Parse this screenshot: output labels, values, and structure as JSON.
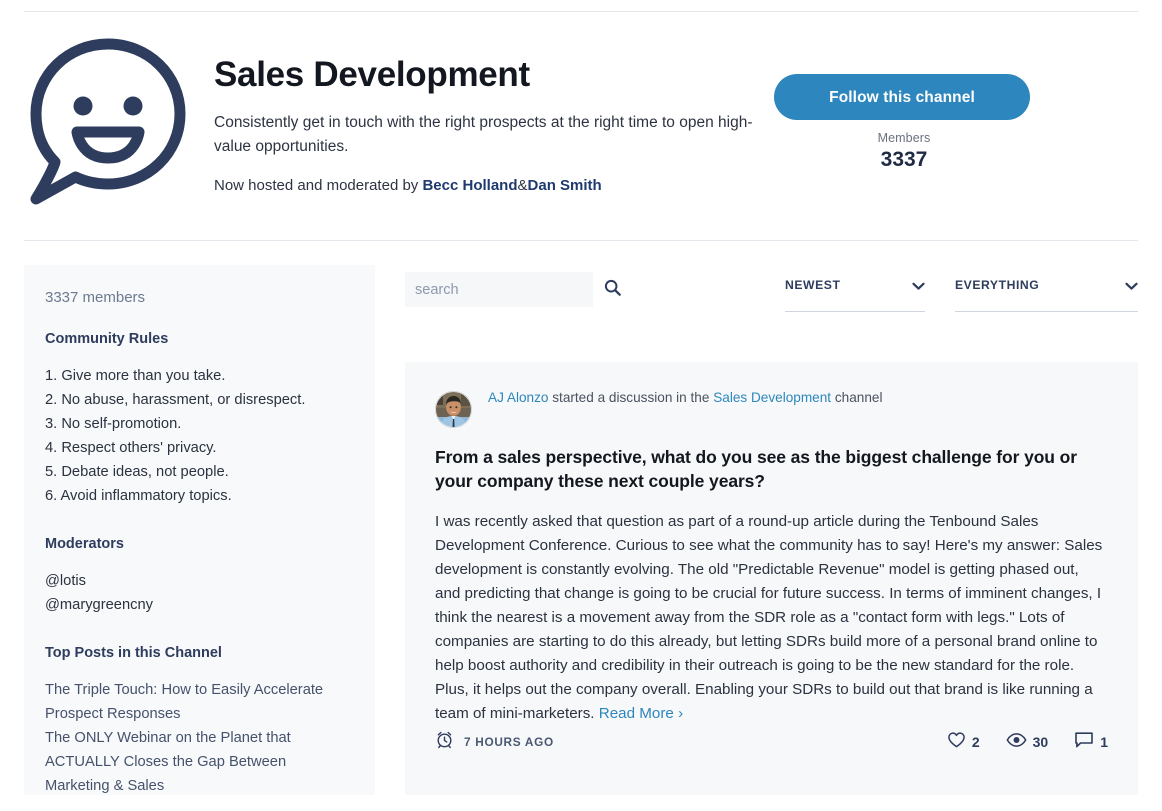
{
  "header": {
    "logo_icon": "speech-bubble-smiley-icon",
    "title": "Sales Development",
    "description": "Consistently get in touch with the right prospects at the right time to open high-value opportunities.",
    "hosted_prefix": "Now hosted and moderated by",
    "host_1": "Becc Holland",
    "host_sep": "&",
    "host_2": "Dan Smith",
    "follow_label": "Follow this channel",
    "members_label": "Members",
    "members_count": "3337",
    "accent_blue": "#2d86bd",
    "navy": "#2e3c5d"
  },
  "sidebar": {
    "members_text": "3337 members",
    "rules_heading": "Community Rules",
    "rules": [
      "1. Give more than you take.",
      "2. No abuse, harassment, or disrespect.",
      "3. No self-promotion.",
      "4. Respect others' privacy.",
      "5. Debate ideas, not people.",
      "6. Avoid inflammatory topics."
    ],
    "moderators_heading": "Moderators",
    "moderators": [
      "@lotis",
      "@marygreencny"
    ],
    "top_posts_heading": "Top Posts in this Channel",
    "top_posts": [
      "The Triple Touch: How to Easily Accelerate Prospect Responses",
      "The ONLY Webinar on the Planet that ACTUALLY Closes the Gap Between Marketing & Sales"
    ]
  },
  "controls": {
    "search_placeholder": "search",
    "search_value": "",
    "search_icon": "search-icon",
    "sort_value": "NEWEST",
    "filter_value": "EVERYTHING",
    "caret_icon": "chevron-down-icon"
  },
  "post": {
    "avatar_icon": "user-avatar",
    "author": "AJ Alonzo",
    "action_text": "started a discussion in the",
    "channel": "Sales Development",
    "channel_suffix": "channel",
    "title": "From a sales perspective, what do you see as the biggest challenge for you or your company these next couple years?",
    "body": "I was recently asked that question as part of a round-up article during the Tenbound Sales Development Conference. Curious to see what the community has to say! Here's my answer: Sales development is constantly evolving. The old \"Predictable Revenue\" model is getting phased out, and predicting that change is going to be crucial for future success. In terms of imminent changes, I think the nearest is a movement away from the SDR role as a \"contact form with legs.\" Lots of companies are starting to do this already, but letting SDRs build more of a personal brand online to help boost authority and credibility in their outreach is going to be the new standard for the role. Plus, it helps out the company overall. Enabling your SDRs to build out that brand is like running a team of mini-marketers.",
    "read_more": "Read More ›",
    "timestamp": "7 HOURS AGO",
    "clock_icon": "alarm-clock-icon",
    "like_icon": "heart-icon",
    "likes": "2",
    "view_icon": "eye-icon",
    "views": "30",
    "comment_icon": "comment-bubble-icon",
    "comments": "1"
  }
}
